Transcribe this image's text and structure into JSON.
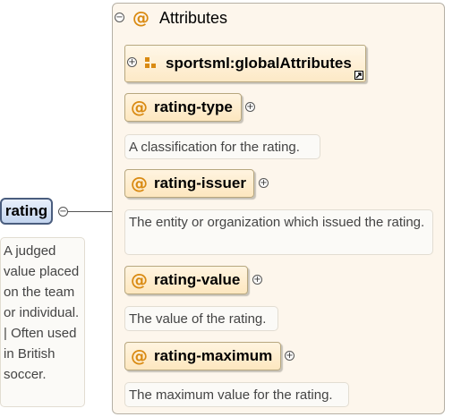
{
  "element": {
    "name": "rating",
    "doc": "A judged value placed on the team or individual. | Often used in British soccer."
  },
  "attributes_group": {
    "title": "Attributes",
    "attribute_group_ref": "sportsml:globalAttributes",
    "attributes": [
      {
        "name": "rating-type",
        "doc": "A classification for the rating."
      },
      {
        "name": "rating-issuer",
        "doc": "The entity or organization which issued the rating."
      },
      {
        "name": "rating-value",
        "doc": "The value of the rating."
      },
      {
        "name": "rating-maximum",
        "doc": "The maximum value for the rating."
      }
    ]
  },
  "symbols": {
    "at": "@",
    "collapse": "−",
    "expand": "+"
  },
  "colors": {
    "element_fill": "#c3d4ee",
    "attribute_fill": "#fde7bf",
    "group_fill": "#fdf6ec",
    "at_symbol": "#d98a12"
  }
}
